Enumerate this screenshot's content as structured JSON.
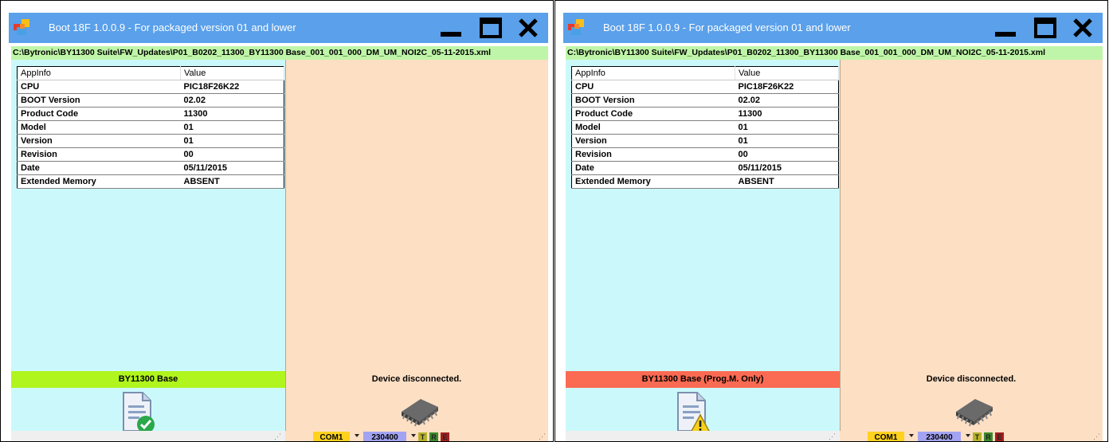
{
  "windows": [
    {
      "title": "Boot 18F 1.0.0.9 - For packaged version 01 and lower",
      "path": "C:\\Bytronic\\BY11300 Suite\\FW_Updates\\P01_B0202_11300_BY11300 Base_001_001_000_DM_UM_NOI2C_05-11-2015.xml",
      "table": {
        "headers": [
          "AppInfo",
          "Value"
        ],
        "rows": [
          {
            "key": "CPU",
            "value": "PIC18F26K22"
          },
          {
            "key": "BOOT Version",
            "value": "02.02"
          },
          {
            "key": "Product Code",
            "value": "11300"
          },
          {
            "key": "Model",
            "value": "01"
          },
          {
            "key": "Version",
            "value": "01"
          },
          {
            "key": "Revision",
            "value": "00"
          },
          {
            "key": "Date",
            "value": "05/11/2015"
          },
          {
            "key": "Extended Memory",
            "value": "ABSENT"
          }
        ]
      },
      "firmware_status": {
        "text": "BY11300 Base",
        "color": "#b0f51d",
        "icon": "document-check-icon"
      },
      "device_status": "Device disconnected.",
      "com_port": "COM1",
      "baud": "230400",
      "leds": [
        {
          "label": "T",
          "color": "#b5b22a"
        },
        {
          "label": "R",
          "color": "#3c8a2a"
        },
        {
          "label": "E",
          "color": "#a01e1e"
        }
      ]
    },
    {
      "title": "Boot 18F 1.0.0.9 - For packaged version 01 and lower",
      "path": "C:\\Bytronic\\BY11300 Suite\\FW_Updates\\P01_B0202_11300_BY11300 Base_001_001_000_DM_UM_NOI2C_05-11-2015.xml",
      "table": {
        "headers": [
          "AppInfo",
          "Value"
        ],
        "rows": [
          {
            "key": "CPU",
            "value": "PIC18F26K22"
          },
          {
            "key": "BOOT Version",
            "value": "02.02"
          },
          {
            "key": "Product Code",
            "value": "11300"
          },
          {
            "key": "Model",
            "value": "01"
          },
          {
            "key": "Version",
            "value": "01"
          },
          {
            "key": "Revision",
            "value": "00"
          },
          {
            "key": "Date",
            "value": "05/11/2015"
          },
          {
            "key": "Extended Memory",
            "value": "ABSENT"
          }
        ]
      },
      "firmware_status": {
        "text": "BY11300 Base (Prog.M. Only)",
        "color": "#fb6a52",
        "icon": "document-warning-icon"
      },
      "device_status": "Device disconnected.",
      "com_port": "COM1",
      "baud": "230400",
      "leds": [
        {
          "label": "T",
          "color": "#b5b22a"
        },
        {
          "label": "R",
          "color": "#3c8a2a"
        },
        {
          "label": "E",
          "color": "#a01e1e"
        }
      ]
    }
  ]
}
